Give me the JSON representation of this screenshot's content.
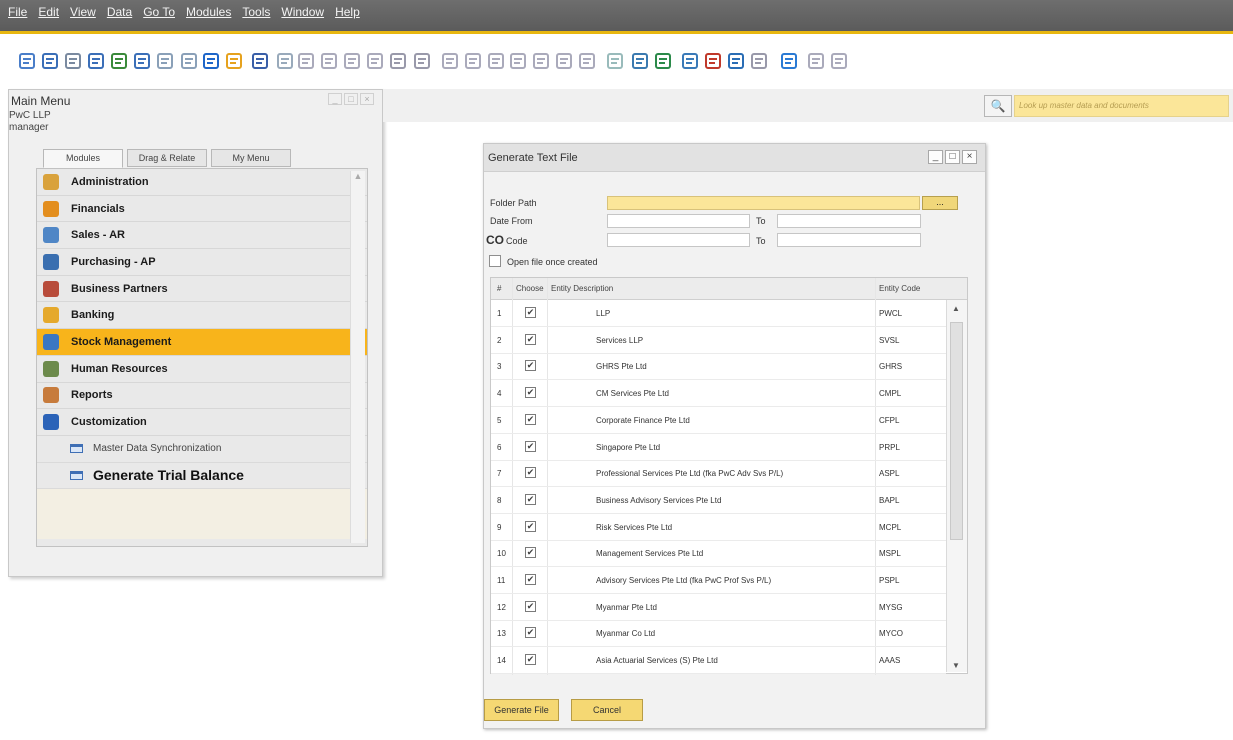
{
  "menubar": {
    "items": [
      "File",
      "Edit",
      "View",
      "Data",
      "Go To",
      "Modules",
      "Tools",
      "Window",
      "Help"
    ]
  },
  "toolbar": {
    "icons": [
      "preview-icon",
      "print-icon",
      "email-icon",
      "export-word-icon",
      "export-excel-icon",
      "launch-icon",
      "lock-icon",
      "doc-icon",
      "arrow-up-icon",
      "folder-icon",
      "binoculars-icon",
      "form-icon",
      "first-record-icon",
      "prev-record-icon",
      "next-record-icon",
      "last-record-icon",
      "filter-icon",
      "sort-icon",
      "base-doc-icon",
      "target-doc-icon",
      "copy-icon",
      "paste-icon",
      "draft-icon",
      "journal-icon",
      "layout-icon",
      "edit-icon",
      "doc-new-icon",
      "doc-export-icon",
      "calendar-icon",
      "message-icon",
      "calc-icon",
      "network-icon",
      "help-icon",
      "settings-icon",
      "extra-icon"
    ]
  },
  "main_menu": {
    "title": "Main Menu",
    "company": "PwC LLP",
    "user": "manager",
    "tabs": [
      "Modules",
      "Drag & Relate",
      "My Menu"
    ],
    "items": [
      {
        "label": "Administration",
        "color": "#d9a23c"
      },
      {
        "label": "Financials",
        "color": "#e38e1e"
      },
      {
        "label": "Sales - AR",
        "color": "#4f86c6"
      },
      {
        "label": "Purchasing - AP",
        "color": "#3a6fb0"
      },
      {
        "label": "Business Partners",
        "color": "#b84c3b"
      },
      {
        "label": "Banking",
        "color": "#e5a92c"
      },
      {
        "label": "Stock Management",
        "color": "#3b77c2"
      },
      {
        "label": "Human Resources",
        "color": "#6c8a4b"
      },
      {
        "label": "Reports",
        "color": "#c77b3c"
      },
      {
        "label": "Customization",
        "color": "#2b63b8"
      }
    ],
    "sub_items": [
      "Master Data Synchronization",
      "Generate Trial Balance"
    ]
  },
  "search": {
    "placeholder": "Look up master data and documents"
  },
  "dialog": {
    "title": "Generate Text File",
    "folder_path_label": "Folder Path",
    "date_from_label": "Date From",
    "to_label": "To",
    "co_prefix": "CO",
    "code_label": "Code",
    "open_file_label": "Open file once created",
    "browse_label": "...",
    "columns": [
      "#",
      "Choose",
      "Entity Description",
      "Entity Code"
    ],
    "rows": [
      {
        "n": "1",
        "desc": "LLP",
        "code": "PWCL"
      },
      {
        "n": "2",
        "desc": "Services LLP",
        "code": "SVSL"
      },
      {
        "n": "3",
        "desc": "GHRS Pte Ltd",
        "code": "GHRS"
      },
      {
        "n": "4",
        "desc": "CM Services Pte Ltd",
        "code": "CMPL"
      },
      {
        "n": "5",
        "desc": "Corporate Finance Pte Ltd",
        "code": "CFPL"
      },
      {
        "n": "6",
        "desc": "Singapore Pte Ltd",
        "code": "PRPL"
      },
      {
        "n": "7",
        "desc": "Professional Services Pte Ltd (fka PwC Adv Svs P/L)",
        "code": "ASPL"
      },
      {
        "n": "8",
        "desc": "Business Advisory Services Pte Ltd",
        "code": "BAPL"
      },
      {
        "n": "9",
        "desc": "Risk Services Pte Ltd",
        "code": "MCPL"
      },
      {
        "n": "10",
        "desc": "Management Services Pte Ltd",
        "code": "MSPL"
      },
      {
        "n": "11",
        "desc": "Advisory Services Pte Ltd (fka PwC Prof Svs P/L)",
        "code": "PSPL"
      },
      {
        "n": "12",
        "desc": "Myanmar Pte Ltd",
        "code": "MYSG"
      },
      {
        "n": "13",
        "desc": "Myanmar Co Ltd",
        "code": "MYCO"
      },
      {
        "n": "14",
        "desc": "Asia Actuarial Services (S) Pte Ltd",
        "code": "AAAS"
      }
    ],
    "generate_button": "Generate File",
    "cancel_button": "Cancel"
  }
}
